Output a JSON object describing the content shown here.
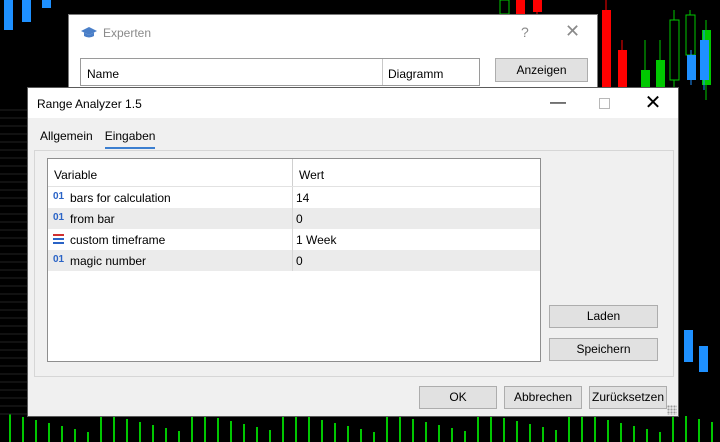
{
  "colors": {
    "chart_bg": "#000000",
    "bull": "#00c800",
    "bear": "#ff0000",
    "accent": "#3c7fd0",
    "param_icon": "#2a63c6"
  },
  "experts_dialog": {
    "title": "Experten",
    "icon": "graduation-cap-icon",
    "help": "?",
    "close": "✕",
    "columns": [
      "Name",
      "Diagramm"
    ],
    "show_button": "Anzeigen"
  },
  "main_dialog": {
    "title": "Range Analyzer 1.5",
    "minimize": "—",
    "close": "✕",
    "tabs": [
      {
        "label": "Allgemein",
        "active": false
      },
      {
        "label": "Eingaben",
        "active": true
      }
    ],
    "grid": {
      "headers": [
        "Variable",
        "Wert"
      ],
      "rows": [
        {
          "icon": "int-param-icon",
          "icon_text": "01",
          "variable": "bars for calculation",
          "value": "14"
        },
        {
          "icon": "int-param-icon",
          "icon_text": "01",
          "variable": "from bar",
          "value": "0"
        },
        {
          "icon": "enum-param-icon",
          "icon_text": "",
          "variable": "custom timeframe",
          "value": "1 Week"
        },
        {
          "icon": "int-param-icon",
          "icon_text": "01",
          "variable": "magic number",
          "value": "0"
        }
      ]
    },
    "buttons": {
      "load": "Laden",
      "save": "Speichern",
      "ok": "OK",
      "cancel": "Abbrechen",
      "reset": "Zurücksetzen"
    }
  }
}
